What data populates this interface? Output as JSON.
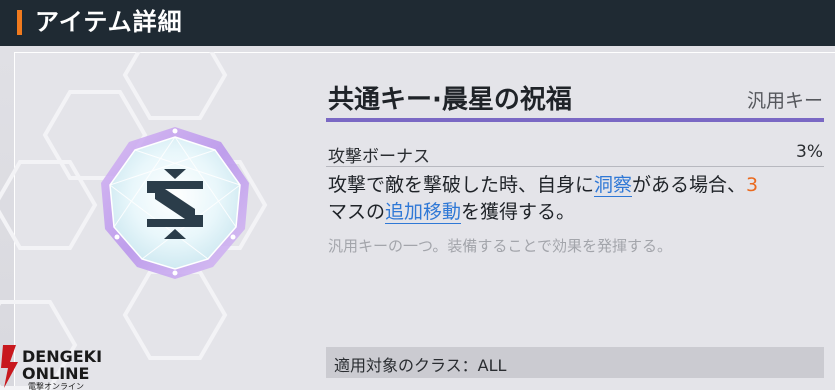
{
  "header": {
    "title": "アイテム詳細",
    "accent_color": "#f07a1e"
  },
  "item": {
    "name": "共通キー·晨星の祝福",
    "category": "汎用キー",
    "icon": "intertwined-rune-emblem-icon",
    "stat": {
      "label": "攻撃ボーナス",
      "value": "3%"
    },
    "description": {
      "part1": "攻撃で敵を撃破した時、自身に",
      "keyword1": "洞察",
      "part2": "がある場合、",
      "number": "3",
      "part3": "マスの",
      "keyword2": "追加移動",
      "part4": "を獲得する。"
    },
    "flavor": "汎用キーの一つ。装備することで効果を発揮する。",
    "target_class": "適用対象のクラス：ALL"
  },
  "watermark": {
    "line1": "DENGEKI",
    "line2": "ONLINE",
    "line3": "電撃オンライン"
  },
  "colors": {
    "header_bg": "#1f2a33",
    "title_rule": "#7a68c4",
    "keyword": "#2f78d6",
    "number": "#ea6a1f"
  }
}
